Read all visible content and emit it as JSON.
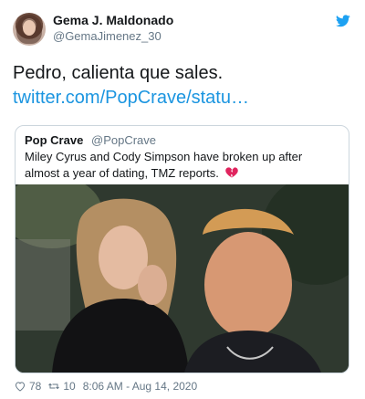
{
  "author": {
    "name": "Gema J. Maldonado",
    "handle": "@GemaJimenez_30"
  },
  "tweet": {
    "text": "Pedro, calienta que sales.",
    "link": "twitter.com/PopCrave/statu…"
  },
  "quoted": {
    "name": "Pop Crave",
    "handle": "@PopCrave",
    "text": "Miley Cyrus and Cody Simpson have broken up after almost a year of dating, TMZ reports."
  },
  "footer": {
    "likes": "78",
    "retweets": "10",
    "timestamp": "8:06 AM - Aug 14, 2020"
  },
  "colors": {
    "link": "#1b95e0",
    "twitter_blue": "#1da1f2",
    "muted": "#657786",
    "heart": "#e0245e"
  },
  "icons": {
    "brand": "twitter-bird-icon",
    "like": "heart-outline-icon",
    "retweet": "retweet-icon",
    "emoji": "broken-heart-icon"
  }
}
